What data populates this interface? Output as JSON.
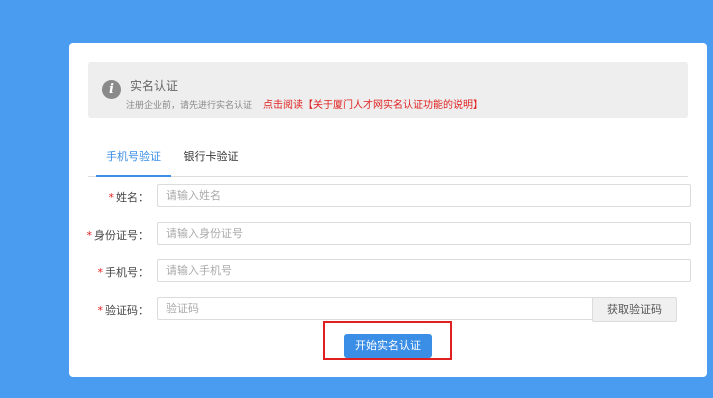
{
  "notice": {
    "icon": "info-icon",
    "title": "实名认证",
    "description": "注册企业前，请先进行实名认证",
    "link_text": "点击阅读【关于厦门人才网实名认证功能的说明】"
  },
  "tabs": [
    {
      "label": "手机号验证",
      "active": true
    },
    {
      "label": "银行卡验证",
      "active": false
    }
  ],
  "form": {
    "required_mark": "*",
    "name": {
      "label": "姓名：",
      "placeholder": "请输入姓名",
      "value": ""
    },
    "id_number": {
      "label": "身份证号：",
      "placeholder": "请输入身份证号",
      "value": ""
    },
    "phone": {
      "label": "手机号：",
      "placeholder": "请输入手机号",
      "value": ""
    },
    "code": {
      "label": "验证码：",
      "placeholder": "验证码",
      "value": ""
    },
    "get_code_label": "获取验证码",
    "submit_label": "开始实名认证"
  },
  "colors": {
    "background": "#4a9cf0",
    "accent": "#3a8ee6",
    "required": "#e02020",
    "highlight_border": "#e02020"
  }
}
